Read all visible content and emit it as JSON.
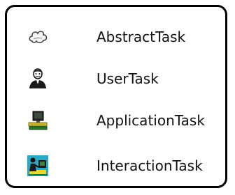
{
  "legend": {
    "items": [
      {
        "label": "AbstractTask",
        "icon": "cloud-icon"
      },
      {
        "label": "UserTask",
        "icon": "user-icon"
      },
      {
        "label": "ApplicationTask",
        "icon": "computer-icon"
      },
      {
        "label": "InteractionTask",
        "icon": "user-computer-icon"
      }
    ]
  },
  "colors": {
    "border": "#000000",
    "text": "#111111",
    "background": "#ffffff"
  }
}
